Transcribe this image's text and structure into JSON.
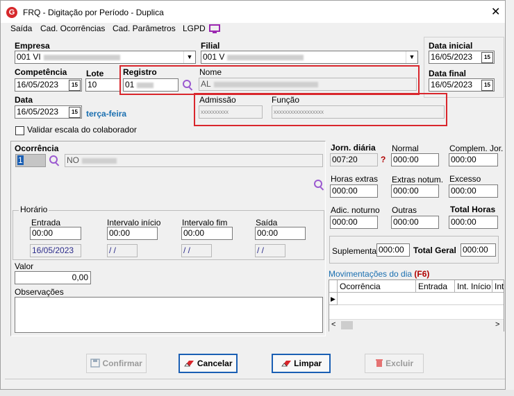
{
  "window": {
    "title": "FRQ - Digitação por Período - Duplica",
    "icon_letter": "G"
  },
  "menu": [
    "Saída",
    "Cad. Ocorrências",
    "Cad. Parâmetros",
    "LGPD"
  ],
  "form": {
    "empresa_label": "Empresa",
    "empresa_value": "001 VI",
    "filial_label": "Filial",
    "filial_value": "001 V",
    "data_inicial_label": "Data inicial",
    "data_inicial_value": "16/05/2023",
    "data_final_label": "Data final",
    "data_final_value": "16/05/2023",
    "competencia_label": "Competência",
    "competencia_value": "16/05/2023",
    "lote_label": "Lote",
    "lote_value": "10",
    "registro_label": "Registro",
    "registro_value": "01",
    "nome_label": "Nome",
    "nome_value": "AL",
    "data_label": "Data",
    "data_value": "16/05/2023",
    "weekday": "terça-feira",
    "admissao_label": "Admissão",
    "admissao_value": "xxxxxxxxxx",
    "funcao_label": "Função",
    "funcao_value": "xxxxxxxxxxxxxxxxxx",
    "validar_label": "Validar escala do colaborador",
    "ocorrencia_label": "Ocorrência",
    "ocorrencia_code": "1",
    "ocorrencia_desc": "NO"
  },
  "horario": {
    "group_label": "Horário",
    "entrada_label": "Entrada",
    "entrada_value": "00:00",
    "entrada_date": "16/05/2023",
    "int_ini_label": "Intervalo início",
    "int_ini_value": "00:00",
    "int_ini_date": "/ /",
    "int_fim_label": "Intervalo fim",
    "int_fim_value": "00:00",
    "int_fim_date": "/ /",
    "saida_label": "Saída",
    "saida_value": "00:00",
    "saida_date": "/ /"
  },
  "valor": {
    "label": "Valor",
    "value": "0,00"
  },
  "observacoes_label": "Observações",
  "hours": {
    "jorn_label": "Jorn. diária",
    "jorn_value": "007:20",
    "help": "?",
    "normal_label": "Normal",
    "normal_value": "000:00",
    "complem_label": "Complem. Jor.",
    "complem_value": "000:00",
    "extras_label": "Horas extras",
    "extras_value": "000:00",
    "extras_not_label": "Extras notum.",
    "extras_not_value": "000:00",
    "excesso_label": "Excesso",
    "excesso_value": "000:00",
    "adic_label": "Adic. noturno",
    "adic_value": "000:00",
    "outras_label": "Outras",
    "outras_value": "000:00",
    "total_label": "Total Horas",
    "total_value": "000:00",
    "suplementar_label": "Suplementar",
    "suplementar_value": "000:00",
    "total_geral_label": "Total Geral",
    "total_geral_value": "000:00"
  },
  "movimentacoes": {
    "label": "Movimentações do dia",
    "shortcut": "(F6)",
    "columns": [
      "Ocorrência",
      "Entrada",
      "Int. Início",
      "Int"
    ]
  },
  "buttons": {
    "confirmar": "Confirmar",
    "cancelar": "Cancelar",
    "limpar": "Limpar",
    "excluir": "Excluir"
  },
  "colors": {
    "accent_red": "#d9262c",
    "link_blue": "#1a6fb0",
    "default_blue": "#1a5fb4"
  }
}
